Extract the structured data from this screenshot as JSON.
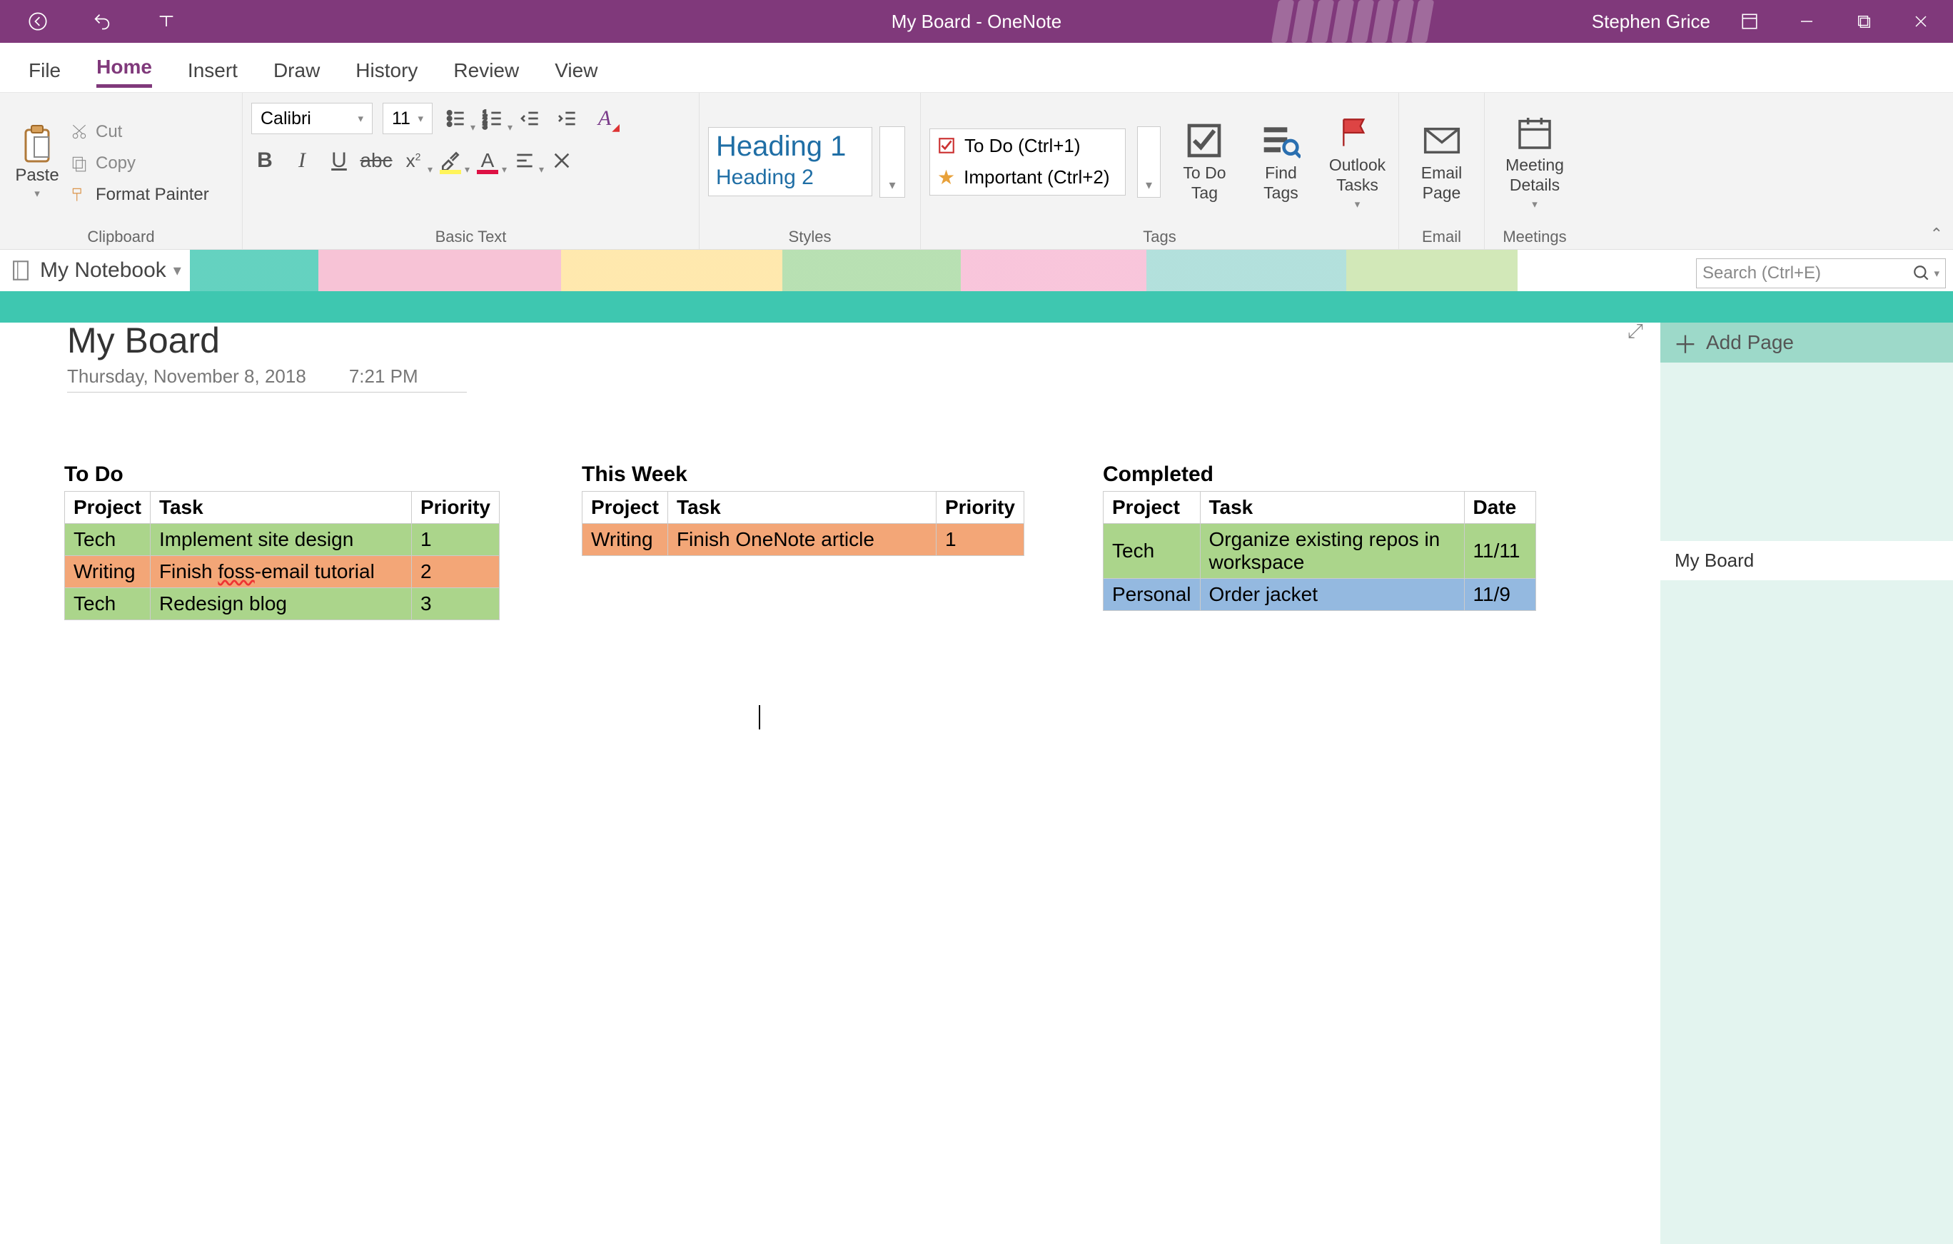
{
  "titlebar": {
    "title": "My Board  -  OneNote",
    "username": "Stephen Grice"
  },
  "menu": {
    "file": "File",
    "home": "Home",
    "insert": "Insert",
    "draw": "Draw",
    "history": "History",
    "review": "Review",
    "view": "View"
  },
  "ribbon": {
    "clipboard": {
      "paste": "Paste",
      "cut": "Cut",
      "copy": "Copy",
      "format_painter": "Format Painter",
      "label": "Clipboard"
    },
    "basic_text": {
      "font": "Calibri",
      "size": "11",
      "label": "Basic Text"
    },
    "styles": {
      "h1": "Heading 1",
      "h2": "Heading 2",
      "label": "Styles"
    },
    "tags": {
      "todo": "To Do (Ctrl+1)",
      "important": "Important (Ctrl+2)",
      "todo_tag": "To Do\nTag",
      "find_tags": "Find\nTags",
      "outlook_tasks": "Outlook\nTasks",
      "label": "Tags"
    },
    "email": {
      "email_page": "Email\nPage",
      "label": "Email"
    },
    "meetings": {
      "meeting_details": "Meeting\nDetails",
      "label": "Meetings"
    }
  },
  "notebook": {
    "name": "My Notebook",
    "search_placeholder": "Search (Ctrl+E)"
  },
  "page_pane": {
    "add_page": "Add Page",
    "active_page": "My Board"
  },
  "page": {
    "title": "My Board",
    "date": "Thursday, November 8, 2018",
    "time": "7:21 PM"
  },
  "boards": {
    "todo": {
      "title": "To Do",
      "headers": {
        "project": "Project",
        "task": "Task",
        "priority": "Priority"
      },
      "rows": [
        {
          "project": "Tech",
          "task": "Implement site design",
          "priority": "1",
          "color": "c-green"
        },
        {
          "project": "Writing",
          "task_prefix": "Finish ",
          "task_spell": "foss",
          "task_suffix": "-email tutorial",
          "priority": "2",
          "color": "c-orange"
        },
        {
          "project": "Tech",
          "task": "Redesign blog",
          "priority": "3",
          "color": "c-green"
        }
      ]
    },
    "this_week": {
      "title": "This Week",
      "headers": {
        "project": "Project",
        "task": "Task",
        "priority": "Priority"
      },
      "rows": [
        {
          "project": "Writing",
          "task": "Finish OneNote article",
          "priority": "1",
          "color": "c-orange"
        }
      ]
    },
    "completed": {
      "title": "Completed",
      "headers": {
        "project": "Project",
        "task": "Task",
        "date": "Date"
      },
      "rows": [
        {
          "project": "Tech",
          "task": "Organize existing repos in workspace",
          "date": "11/11",
          "color": "c-green"
        },
        {
          "project": "Personal",
          "task": "Order jacket",
          "date": "11/9",
          "color": "c-blue"
        }
      ]
    }
  }
}
